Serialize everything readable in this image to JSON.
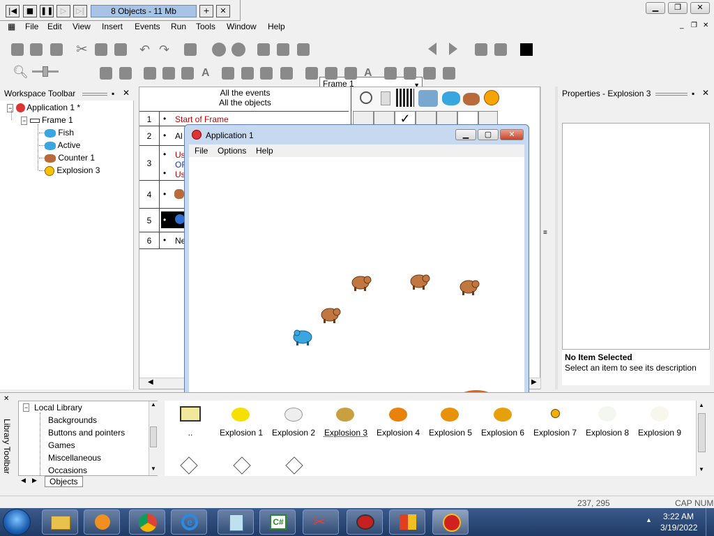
{
  "player": {
    "objects_info": "8 Objects - 11 Mb"
  },
  "menu": {
    "file": "File",
    "edit": "Edit",
    "view": "View",
    "insert": "Insert",
    "events": "Events",
    "run": "Run",
    "tools": "Tools",
    "window": "Window",
    "help": "Help"
  },
  "toolbar": {
    "frame_select": "Frame 1",
    "zoom": "100"
  },
  "workspace": {
    "title": "Workspace Toolbar",
    "app": "Application 1 *",
    "frame": "Frame 1",
    "objects": [
      "Fish",
      "Active",
      "Counter 1",
      "Explosion 3"
    ]
  },
  "events": {
    "header_line1": "All the events",
    "header_line2": "All the objects",
    "rows": [
      {
        "num": "1",
        "text": "Start of Frame"
      },
      {
        "num": "2",
        "text": "Al"
      },
      {
        "num": "3",
        "text": "Us"
      },
      {
        "num": "4",
        "text": ""
      },
      {
        "num": "5",
        "text": ""
      },
      {
        "num": "6",
        "text": "Ne"
      }
    ],
    "row3_extra1": "OR",
    "row3_extra2": "Us"
  },
  "app_window": {
    "title": "Application 1",
    "menu": [
      "File",
      "Options",
      "Help"
    ]
  },
  "properties": {
    "title": "Properties - Explosion 3",
    "no_item": "No Item Selected",
    "hint": "Select an item to see its description"
  },
  "library": {
    "title": "Library Toolbar",
    "local": "Local Library",
    "folders": [
      "Backgrounds",
      "Buttons and pointers",
      "Games",
      "Miscellaneous",
      "Occasions"
    ],
    "tab": "Objects",
    "items": [
      "..",
      "Explosion 1",
      "Explosion 2",
      "Explosion 3",
      "Explosion 4",
      "Explosion 5",
      "Explosion 6",
      "Explosion 7",
      "Explosion 8",
      "Explosion 9"
    ]
  },
  "status": {
    "coords": "237, 295",
    "cap": "CAP",
    "num": "NUM"
  },
  "taskbar": {
    "time": "3:22 AM",
    "date": "3/19/2022"
  },
  "colors": {
    "highlight": "#a7c4e6",
    "event_red": "#c00000",
    "taskbar": "#1f3a66"
  }
}
